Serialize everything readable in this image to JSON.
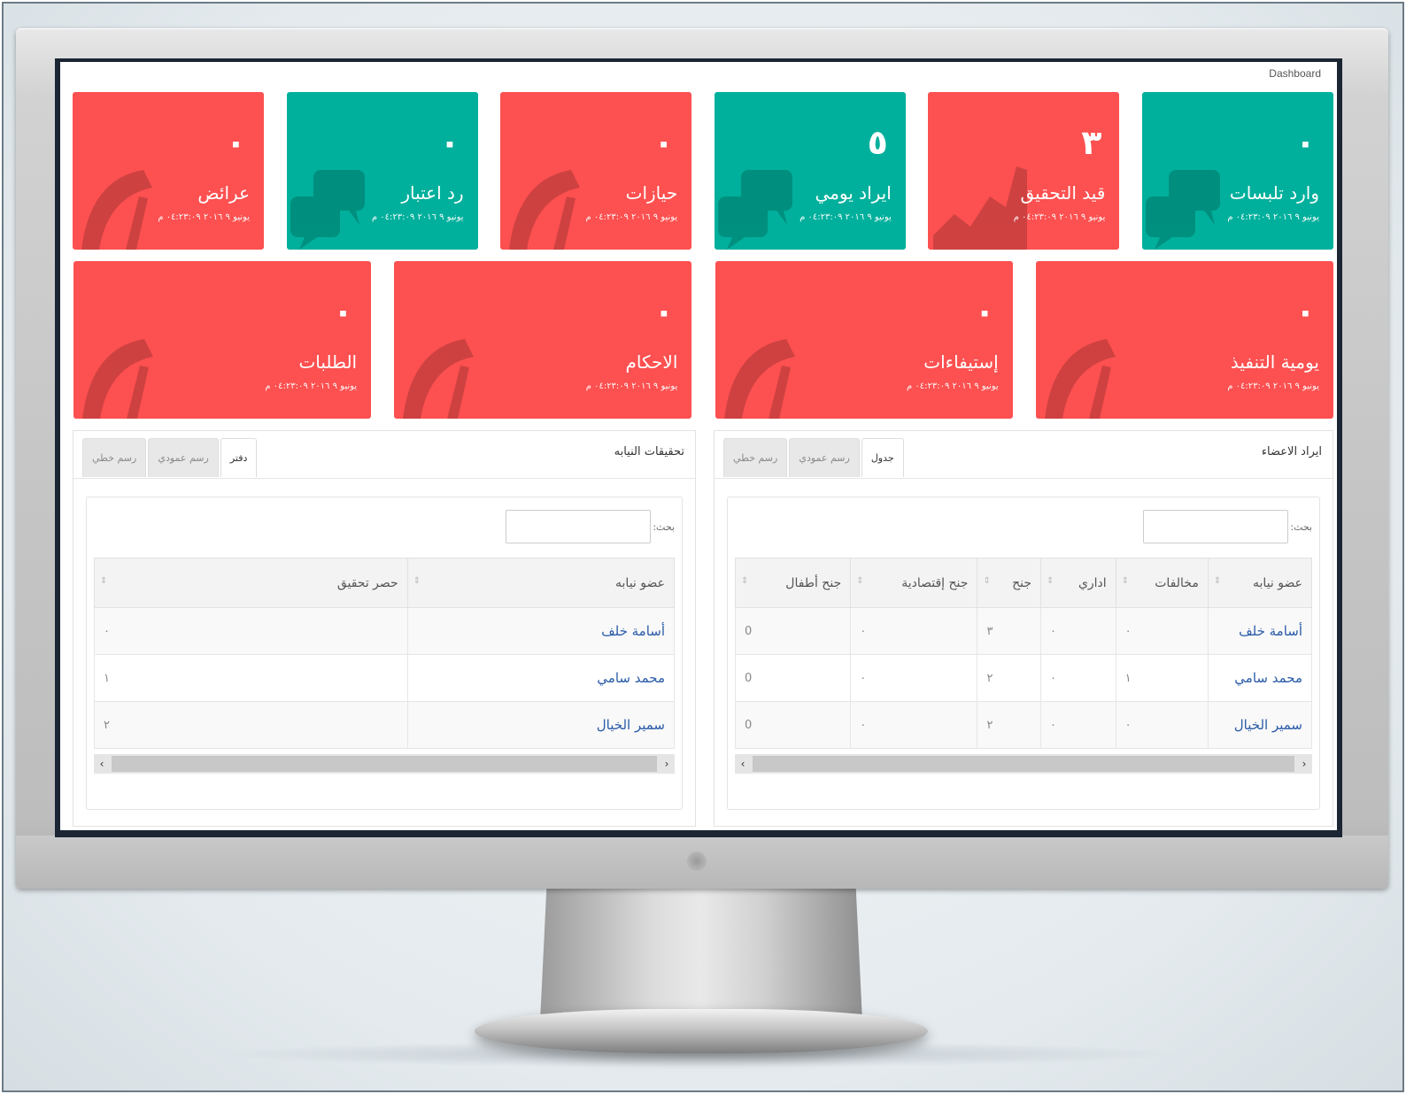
{
  "breadcrumb": "Dashboard",
  "colors": {
    "red": "#fd5050",
    "teal": "#00b09c",
    "link": "#2a5ba8"
  },
  "tiles_row1": [
    {
      "count": "٠",
      "label": "وارد تلبسات",
      "date": "يونيو ٩ ٢٠١٦ ٠٤:٢٣:٠٩ م",
      "color": "teal",
      "icon": "chat-icon"
    },
    {
      "count": "٣",
      "label": "قيد التحقيق",
      "date": "يونيو ٩ ٢٠١٦ ٠٤:٢٣:٠٩ م",
      "color": "red",
      "icon": "area-chart-icon"
    },
    {
      "count": "٥",
      "label": "ايراد يومي",
      "date": "يونيو ٩ ٢٠١٦ ٠٤:٢٣:٠٩ م",
      "color": "teal",
      "icon": "chat-icon"
    },
    {
      "count": "٠",
      "label": "حيازات",
      "date": "يونيو ٩ ٢٠١٦ ٠٤:٢٣:٠٩ م",
      "color": "red",
      "icon": "gauge-icon"
    },
    {
      "count": "٠",
      "label": "رد اعتبار",
      "date": "يونيو ٩ ٢٠١٦ ٠٤:٢٣:٠٩ م",
      "color": "teal",
      "icon": "chat-icon"
    },
    {
      "count": "٠",
      "label": "عرائض",
      "date": "يونيو ٩ ٢٠١٦ ٠٤:٢٣:٠٩ م",
      "color": "red",
      "icon": "gauge-icon"
    }
  ],
  "tiles_row2": [
    {
      "count": "٠",
      "label": "يومية التنفيذ",
      "date": "يونيو ٩ ٢٠١٦ ٠٤:٢٣:٠٩ م",
      "color": "red",
      "icon": "gauge-icon"
    },
    {
      "count": "٠",
      "label": "إستيفاءات",
      "date": "يونيو ٩ ٢٠١٦ ٠٤:٢٣:٠٩ م",
      "color": "red",
      "icon": "gauge-icon"
    },
    {
      "count": "٠",
      "label": "الاحكام",
      "date": "يونيو ٩ ٢٠١٦ ٠٤:٢٣:٠٩ م",
      "color": "red",
      "icon": "gauge-icon"
    },
    {
      "count": "٠",
      "label": "الطلبات",
      "date": "يونيو ٩ ٢٠١٦ ٠٤:٢٣:٠٩ م",
      "color": "red",
      "icon": "gauge-icon"
    }
  ],
  "panel_members": {
    "title": "ايراد الاعضاء",
    "tabs": [
      "جدول",
      "رسم عمودي",
      "رسم خطي"
    ],
    "active_tab": "جدول",
    "search_label": "بحث:",
    "columns": [
      "عضو نيابه",
      "مخالفات",
      "اداري",
      "جنح",
      "جنح إقتصادية",
      "جنح أطفال"
    ],
    "rows": [
      [
        "أسامة خلف",
        "٠",
        "٠",
        "٣",
        "٠",
        "0"
      ],
      [
        "محمد سامي",
        "١",
        "٠",
        "٢",
        "٠",
        "0"
      ],
      [
        "سمير الخيال",
        "٠",
        "٠",
        "٢",
        "٠",
        "0"
      ]
    ]
  },
  "panel_investigations": {
    "title": "تحقيقات النيابه",
    "tabs": [
      "دفتر",
      "رسم عمودي",
      "رسم خطي"
    ],
    "active_tab": "دفتر",
    "search_label": "بحث:",
    "columns": [
      "عضو نيابه",
      "حصر تحقيق"
    ],
    "rows": [
      [
        "أسامة خلف",
        "٠"
      ],
      [
        "محمد سامي",
        "١"
      ],
      [
        "سمير الخيال",
        "٢"
      ]
    ]
  }
}
